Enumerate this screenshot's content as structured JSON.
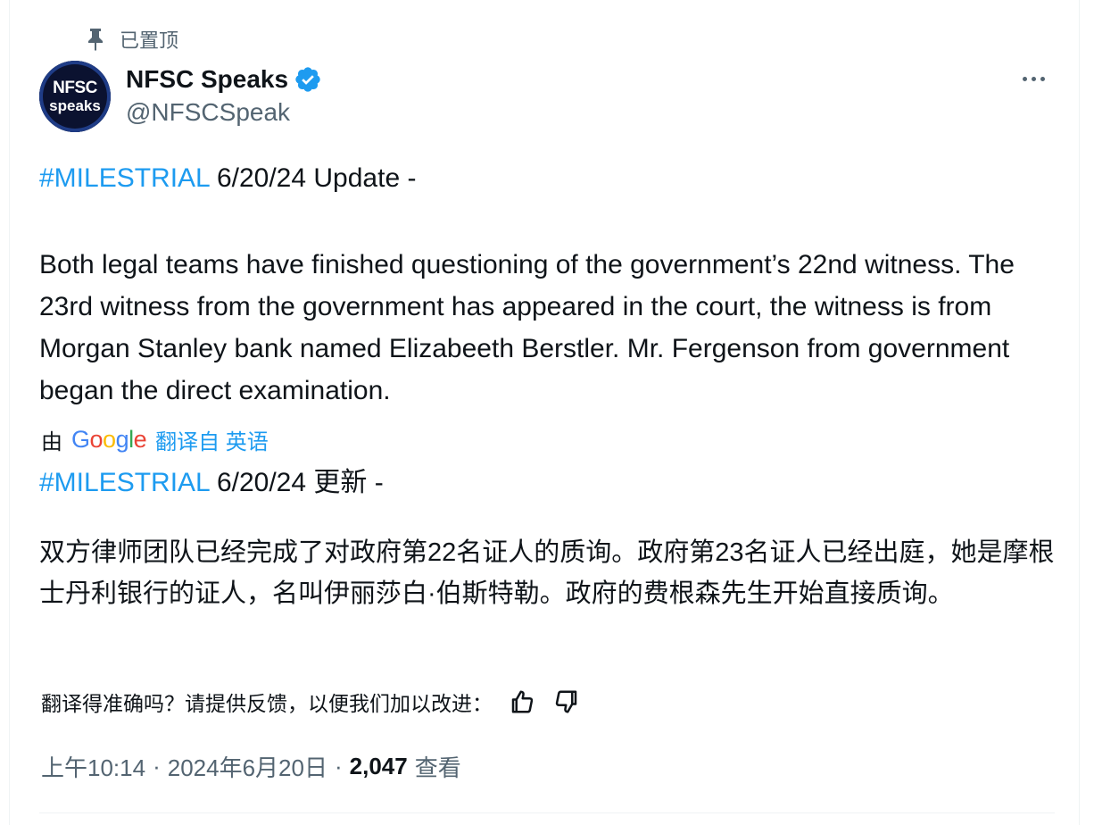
{
  "pinned_label": "已置顶",
  "author": {
    "display_name": "NFSC Speaks",
    "handle": "@NFSCSpeak",
    "avatar_line1": "NFSC",
    "avatar_line2": "speaks",
    "verified_color": "#1d9bf0"
  },
  "tweet": {
    "original_hashtag": "#MILESTRIAL",
    "original_heading_rest": " 6/20/24 Update -",
    "original_body": "Both legal teams have finished questioning of the government’s 22nd witness. The 23rd witness from the government has appeared in the court, the witness is from Morgan Stanley bank named Elizabeeth Berstler. Mr. Fergenson from government began the direct examination.",
    "translated_hashtag": "#MILESTRIAL",
    "translated_heading_rest": " 6/20/24 更新 -",
    "translated_body": "双方律师团队已经完成了对政府第22名证人的质询。政府第23名证人已经出庭，她是摩根士丹利银行的证人，名叫伊丽莎白·伯斯特勒。政府的费根森先生开始直接质询。"
  },
  "translation": {
    "by_label": "由",
    "provider_letters": [
      "G",
      "o",
      "o",
      "g",
      "l",
      "e"
    ],
    "translated_from_label": "翻译自 英语",
    "feedback_prompt": "翻译得准确吗？请提供反馈，以便我们加以改进："
  },
  "meta": {
    "time": "上午10:14",
    "separator": "·",
    "date": "2024年6月20日",
    "views_count": "2,047",
    "views_label": "查看"
  },
  "colors": {
    "accent": "#1d9bf0",
    "secondary_text": "#536471",
    "primary_text": "#0f1419"
  },
  "icons": {
    "pin": "pin-icon",
    "verified": "verified-badge-icon",
    "more": "more-options-icon",
    "thumbs_up": "thumbs-up-icon",
    "thumbs_down": "thumbs-down-icon"
  }
}
